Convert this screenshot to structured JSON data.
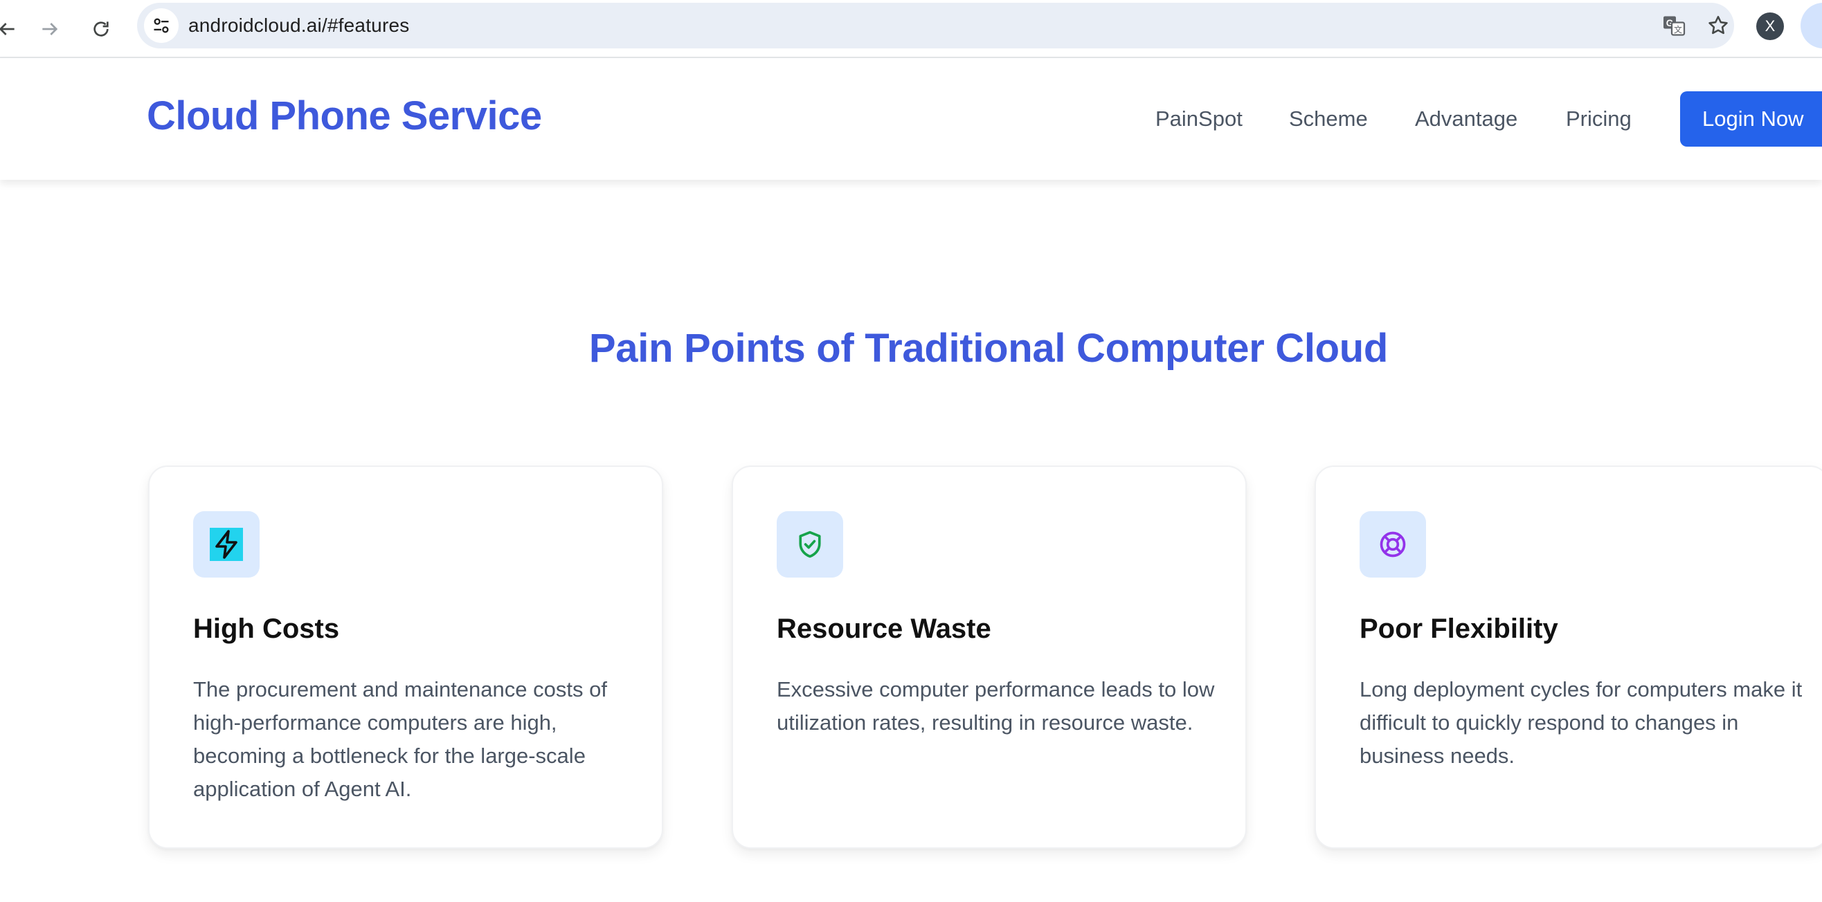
{
  "browser": {
    "url": "androidcloud.ai/#features",
    "profile_initial": "X"
  },
  "header": {
    "brand": "Cloud Phone Service",
    "nav": [
      "PainSpot",
      "Scheme",
      "Advantage",
      "Pricing"
    ],
    "login_label": "Login Now"
  },
  "section": {
    "title": "Pain Points of Traditional Computer Cloud",
    "cards": [
      {
        "icon": "lightning-icon",
        "title": "High Costs",
        "text": "The procurement and maintenance costs of high-performance computers are high, becoming a bottleneck for the large-scale application of Agent AI."
      },
      {
        "icon": "shield-check-icon",
        "title": "Resource Waste",
        "text": "Excessive computer performance leads to low utilization rates, resulting in resource waste."
      },
      {
        "icon": "lifebuoy-icon",
        "title": "Poor Flexibility",
        "text": "Long deployment cycles for computers make it difficult to quickly respond to changes in business needs."
      }
    ]
  },
  "colors": {
    "brand": "#3e59dc",
    "button": "#2563eb",
    "icon_bg": "#dbeafe",
    "lightning_bg": "#22d3ee",
    "shield": "#16a34a",
    "lifebuoy": "#9333ea"
  }
}
